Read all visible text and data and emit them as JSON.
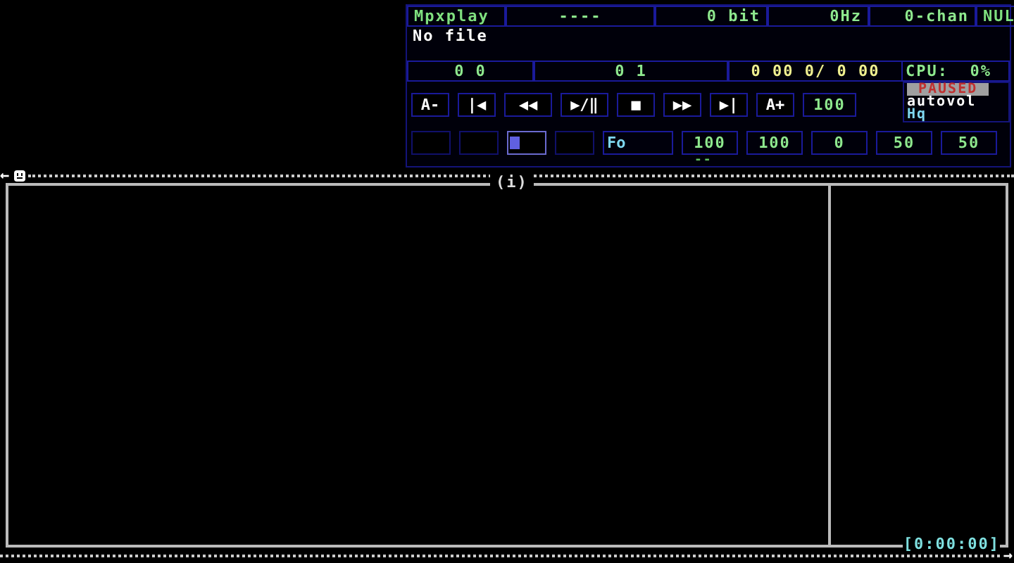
{
  "info_bar": [
    {
      "text": "Mpxplay",
      "kind": "title"
    },
    {
      "text": "----",
      "kind": "plain"
    },
    {
      "text": "0 bit",
      "kind": "plain"
    },
    {
      "text": "0Hz",
      "kind": "plain"
    },
    {
      "text": "0-chan",
      "kind": "plain"
    },
    {
      "text": "NUL",
      "kind": "title"
    }
  ],
  "filename": "No file",
  "counters": [
    "0 0",
    "0 1"
  ],
  "time_display": "0 00 0/ 0 00",
  "cpu": "CPU:  0%",
  "status": {
    "paused": true,
    "paused_label": "PAUSED",
    "autovol": "autovol",
    "hq": "Hq"
  },
  "transport": [
    "A-",
    "|◀",
    "◀◀",
    "▶/‖",
    "■",
    "▶▶",
    "▶|",
    "A+"
  ],
  "volume": "100",
  "toggles": [
    {
      "on": false,
      "focused": false
    },
    {
      "on": false,
      "focused": false
    },
    {
      "on": false,
      "focused": true
    },
    {
      "on": false,
      "focused": false
    },
    {
      "label": "Fo",
      "on": true,
      "focused": false
    }
  ],
  "levels": [
    "100",
    "100",
    "0",
    "50",
    "50"
  ],
  "separator_mark": "--",
  "left_arrow": "←",
  "frame_title": "(i)",
  "elapsed": "[0:00:00]",
  "right_arrow": "→"
}
